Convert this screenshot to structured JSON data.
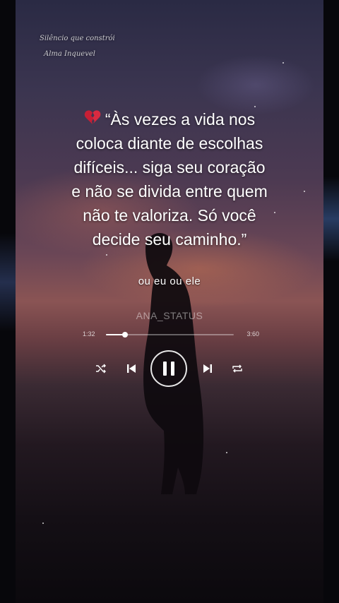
{
  "watermark": {
    "line1": "Silêncio que constrói",
    "line2": "Alma Inquevel"
  },
  "quote": {
    "icon": "broken-heart-icon",
    "lines": [
      "“Às vezes a vida nos",
      "coloca diante de escolhas",
      "difíceis... siga seu coração",
      "e não se divida entre quem",
      "não te valoriza. Só você",
      "decide seu caminho.”"
    ]
  },
  "lyric": "ou eu ou ele",
  "player": {
    "artist": "ANA_STATUS",
    "elapsed": "1:32",
    "total": "3:60",
    "progress": 0.15,
    "controls": {
      "shuffle": "shuffle-icon",
      "previous": "previous-icon",
      "play_pause": "pause-icon",
      "next": "next-icon",
      "repeat": "repeat-icon"
    }
  },
  "colors": {
    "text": "#ffffff",
    "muted": "#9a9aa2"
  }
}
